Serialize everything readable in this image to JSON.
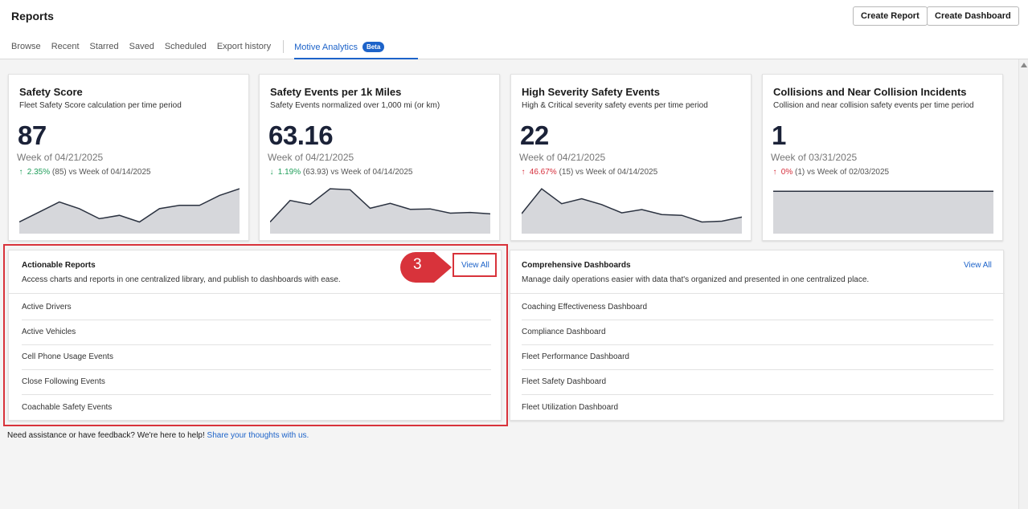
{
  "header": {
    "title": "Reports",
    "create_report_label": "Create Report",
    "create_dashboard_label": "Create Dashboard",
    "tabs": [
      {
        "label": "Browse",
        "active": false
      },
      {
        "label": "Recent",
        "active": false
      },
      {
        "label": "Starred",
        "active": false
      },
      {
        "label": "Saved",
        "active": false
      },
      {
        "label": "Scheduled",
        "active": false
      },
      {
        "label": "Export history",
        "active": false
      },
      {
        "label": "Motive Analytics",
        "active": true,
        "badge": "Beta"
      }
    ]
  },
  "kpis": [
    {
      "title": "Safety Score",
      "subtitle": "Fleet Safety Score calculation per time period",
      "value": "87",
      "week": "Week of 04/21/2025",
      "change_pct": "2.35%",
      "change_detail": "(85) vs Week of 04/14/2025",
      "direction": "up-green",
      "arrow": "↑",
      "sparkline": [
        86,
        86.3,
        86.6,
        86.4,
        86.1,
        86.2,
        86.0,
        86.4,
        86.5,
        86.5,
        86.8,
        87
      ]
    },
    {
      "title": "Safety Events per 1k Miles",
      "subtitle": "Safety Events normalized over 1,000 mi (or km)",
      "value": "63.16",
      "week": "Week of 04/21/2025",
      "change_pct": "1.19%",
      "change_detail": "(63.93) vs Week of 04/14/2025",
      "direction": "down-green",
      "arrow": "↓",
      "sparkline": [
        59,
        70,
        68,
        76,
        75.5,
        66,
        68.5,
        65.5,
        65.7,
        63.5,
        63.9,
        63.16
      ]
    },
    {
      "title": "High Severity Safety Events",
      "subtitle": "High & Critical severity safety events per time period",
      "value": "22",
      "week": "Week of 04/21/2025",
      "change_pct": "46.67%",
      "change_detail": "(15) vs Week of 04/14/2025",
      "direction": "up-red",
      "arrow": "↑",
      "sparkline": [
        21,
        36,
        27,
        30,
        26.5,
        21.5,
        23.5,
        20.5,
        20,
        16,
        16.5,
        19
      ]
    },
    {
      "title": "Collisions and Near Collision Incidents",
      "subtitle": "Collision and near collision safety events per time period",
      "value": "1",
      "week": "Week of 03/31/2025",
      "change_pct": "0%",
      "change_detail": "(1) vs Week of 02/03/2025",
      "direction": "up-red",
      "arrow": "↑",
      "sparkline": [
        1,
        1,
        1,
        1,
        1,
        1,
        1,
        1,
        1,
        1,
        1,
        1
      ]
    }
  ],
  "actionable": {
    "title": "Actionable Reports",
    "description": "Access charts and reports in one centralized library, and publish to dashboards with ease.",
    "view_all": "View All",
    "items": [
      "Active Drivers",
      "Active Vehicles",
      "Cell Phone Usage Events",
      "Close Following Events",
      "Coachable Safety Events"
    ]
  },
  "dashboards": {
    "title": "Comprehensive Dashboards",
    "description": "Manage daily operations easier with data that's organized and presented in one centralized place.",
    "view_all": "View All",
    "items": [
      "Coaching Effectiveness Dashboard",
      "Compliance Dashboard",
      "Fleet Performance Dashboard",
      "Fleet Safety Dashboard",
      "Fleet Utilization Dashboard"
    ]
  },
  "annotation": {
    "step_number": "3"
  },
  "footer": {
    "text": "Need assistance or have feedback? We're here to help! ",
    "link": "Share your thoughts with us."
  },
  "colors": {
    "accent": "#1d63c9",
    "highlight": "#d8333b",
    "positive": "#1f9e5a",
    "negative": "#d62e3b"
  }
}
